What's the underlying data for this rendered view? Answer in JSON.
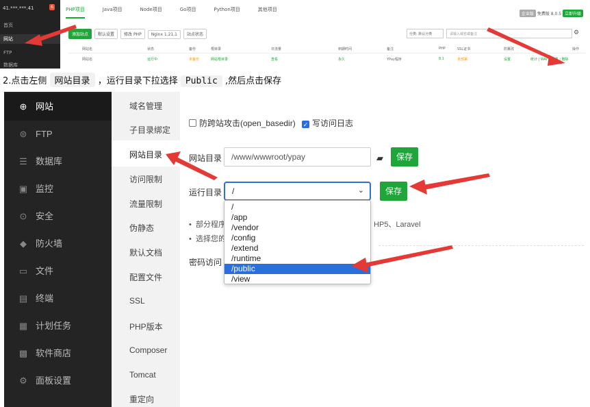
{
  "top": {
    "server": "41.***.***.41",
    "badge": "6",
    "sidebar": [
      "首页",
      "网站",
      "FTP",
      "数据库"
    ],
    "tabs": [
      "PHP项目",
      "Java项目",
      "Node项目",
      "Go项目",
      "Python项目",
      "其他项目"
    ],
    "right": [
      "企业版",
      "免费版",
      "8.0.5",
      "立即升级"
    ],
    "toolbar": [
      "添加站点",
      "默认设置",
      "修改 PHP",
      "Nginx 1.21.1",
      "站点状态"
    ],
    "filter": "分类: 默认分类",
    "search_placeholder": "请输入域名或备注",
    "headers": [
      "网站名",
      "状态",
      "备份",
      "根目录",
      "日流量",
      "到期时间",
      "备注",
      "PHP",
      "SSL证书",
      "防篡改",
      "操作"
    ],
    "row": [
      "网站名",
      "运行中",
      "未备份",
      "网站根目录",
      "查看",
      "永久",
      "YPay程序",
      "8.1",
      "未部署",
      "设置",
      "统计 | WAF | 设置 | 删除"
    ]
  },
  "heading": {
    "prefix": "2.点击左侧",
    "code1": "网站目录",
    "mid": "，运行目录下拉选择",
    "code2": "Public",
    "suffix": ",然后点击保存"
  },
  "nav": [
    "网站",
    "FTP",
    "数据库",
    "监控",
    "安全",
    "防火墙",
    "文件",
    "终端",
    "计划任务",
    "软件商店",
    "面板设置"
  ],
  "tabs": [
    "域名管理",
    "子目录绑定",
    "网站目录",
    "访问限制",
    "流量限制",
    "伪静态",
    "默认文档",
    "配置文件",
    "SSL",
    "PHP版本",
    "Composer",
    "Tomcat",
    "重定向"
  ],
  "content": {
    "chk1": "防跨站攻击(open_basedir)",
    "chk2": "写访问日志",
    "site_dir_label": "网站目录",
    "site_dir_value": "/www/wwwroot/ypay",
    "save": "保存",
    "run_dir_label": "运行目录",
    "run_dir_value": "/",
    "options": [
      "/",
      "/app",
      "/vendor",
      "/config",
      "/extend",
      "/runtime",
      "/public",
      "/view"
    ],
    "note1_a": "部分程序",
    "note1_b": "HP5、Laravel",
    "note2": "选择您的",
    "pwd_label": "密码访问"
  }
}
